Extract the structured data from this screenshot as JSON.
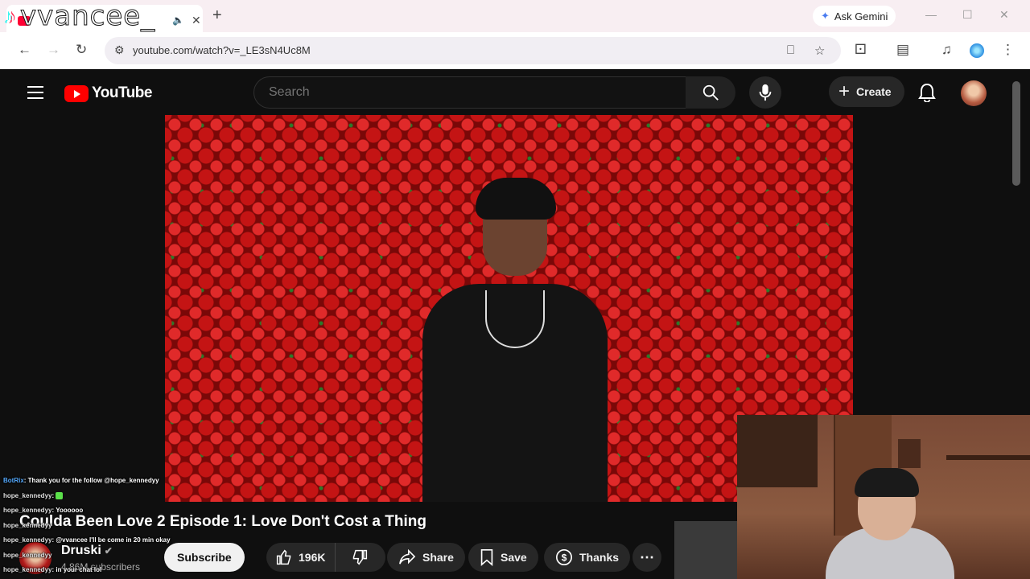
{
  "browser": {
    "tab_title": "vvancee_",
    "url": "youtube.com/watch?v=_LE3sN4Uc8M",
    "ask_gemini": "Ask Gemini"
  },
  "overlay": {
    "streamer_name": "vvancee_"
  },
  "youtube": {
    "logo_text": "YouTube",
    "search_placeholder": "Search",
    "create_label": "Create"
  },
  "video": {
    "title": "Coulda Been Love 2 Episode 1: Love Don't Cost a Thing",
    "channel": "Druski",
    "subscribers": "4.86M subscribers",
    "subscribe_label": "Subscribe",
    "likes": "196K",
    "share_label": "Share",
    "save_label": "Save",
    "thanks_label": "Thanks"
  },
  "chat": [
    {
      "user": "BotRix",
      "message": "Thank you for the follow @hope_kennedyy",
      "bot": true
    },
    {
      "user": "hope_kennedyy",
      "message": "",
      "emote": true
    },
    {
      "user": "hope_kennedyy",
      "message": "Yoooooo"
    },
    {
      "user": "hope_kennedyy",
      "message": ""
    },
    {
      "user": "hope_kennedyy",
      "message": "@vvancee I'll be come in 20 min okay"
    },
    {
      "user": "hope_kennedyy",
      "message": ""
    },
    {
      "user": "hope_kennedyy",
      "message": "in your chat lol"
    }
  ],
  "colors": {
    "youtube_red": "#ff0000",
    "dark_bg": "#0f0f0f",
    "pill_bg": "#272727"
  },
  "icons": [
    "tiktok-icon",
    "search-icon",
    "mic-icon",
    "bell-icon",
    "like-icon",
    "dislike-icon",
    "share-icon",
    "save-icon",
    "thanks-icon",
    "more-icon"
  ]
}
